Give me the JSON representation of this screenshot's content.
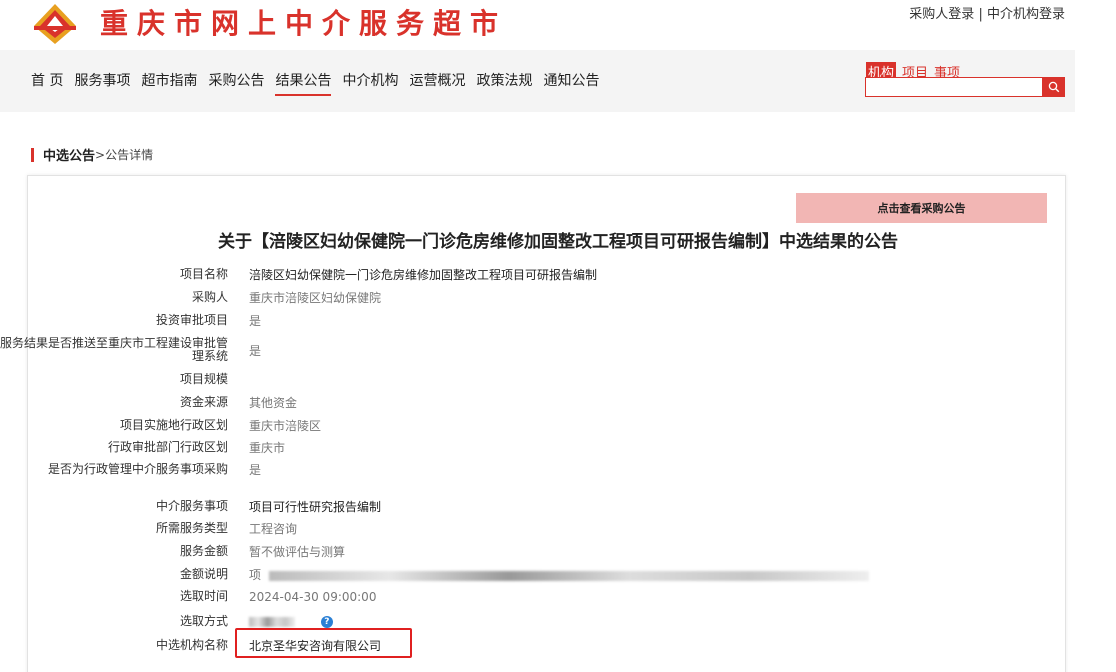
{
  "header": {
    "site_title": "重庆市网上中介服务超市",
    "login_buyer": "采购人登录",
    "separator": "|",
    "login_agency": "中介机构登录",
    "brand_color": "#d9322b"
  },
  "nav": {
    "items": [
      {
        "label": "首 页"
      },
      {
        "label": "服务事项"
      },
      {
        "label": "超市指南"
      },
      {
        "label": "采购公告"
      },
      {
        "label": "结果公告"
      },
      {
        "label": "中介机构"
      },
      {
        "label": "运营概况"
      },
      {
        "label": "政策法规"
      },
      {
        "label": "通知公告"
      }
    ],
    "active": "结果公告"
  },
  "search": {
    "tabs": [
      {
        "label": "机构"
      },
      {
        "label": "项目"
      },
      {
        "label": "事项"
      }
    ],
    "active_tab": "机构",
    "value": "",
    "button_icon": "search-icon"
  },
  "breadcrumb": {
    "section": "中选公告",
    "sep": ">",
    "page": "公告详情"
  },
  "detail": {
    "view_button": "点击查看采购公告",
    "headline": "关于【涪陵区妇幼保健院一门诊危房维修加固整改工程项目可研报告编制】中选结果的公告",
    "fields": [
      {
        "label": "项目名称",
        "value": "涪陵区妇幼保健院一门诊危房维修加固整改工程项目可研报告编制"
      },
      {
        "label": "采购人",
        "value": "重庆市涪陵区妇幼保健院"
      },
      {
        "label": "投资审批项目",
        "value": "是"
      },
      {
        "label": "服务结果是否推送至重庆市工程建设审批管理系统",
        "value": "是"
      },
      {
        "label": "项目规模",
        "value": ""
      },
      {
        "label": "资金来源",
        "value": "其他资金"
      },
      {
        "label": "项目实施地行政区划",
        "value": "重庆市涪陵区"
      },
      {
        "label": "行政审批部门行政区划",
        "value": "重庆市"
      },
      {
        "label": "是否为行政管理中介服务事项采购",
        "value": "是"
      },
      {
        "label": "中介服务事项",
        "value": "项目可行性研究报告编制"
      },
      {
        "label": "所需服务类型",
        "value": "工程咨询"
      },
      {
        "label": "服务金额",
        "value": "暂不做评估与测算"
      },
      {
        "label": "金额说明",
        "value": "项"
      },
      {
        "label": "选取时间",
        "value": "2024-04-30 09:00:00"
      },
      {
        "label": "选取方式",
        "value": ""
      },
      {
        "label": "中选机构名称",
        "value": "北京圣华安咨询有限公司"
      }
    ]
  },
  "colors": {
    "view_button_bg": "#f2b6b4",
    "highlight_border": "#e02020",
    "help_icon": "#2a7fd4"
  }
}
